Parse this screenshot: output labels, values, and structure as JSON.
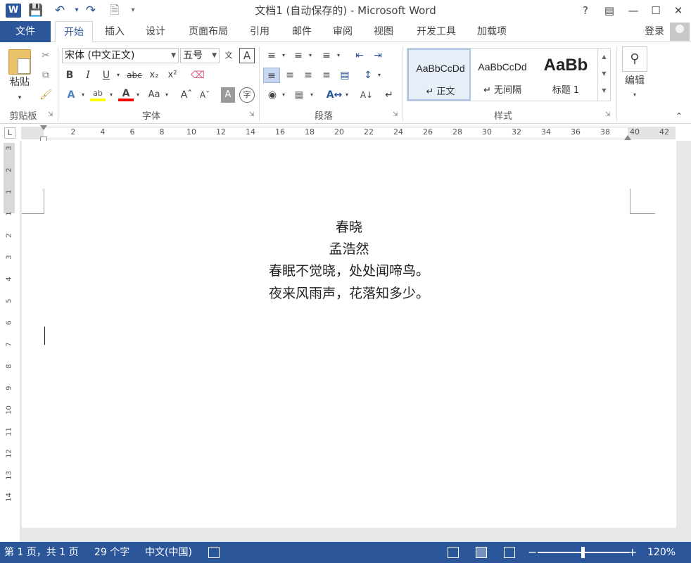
{
  "titlebar": {
    "app_icon": "W",
    "title": "文档1 (自动保存的) - Microsoft Word",
    "qat": [
      "save-icon",
      "undo-icon",
      "redo-icon",
      "print-preview-icon",
      "customize-qat-icon"
    ],
    "help": "?",
    "buttons": [
      "ribbon-display-icon",
      "minimize-icon",
      "maximize-icon",
      "close-icon"
    ]
  },
  "tabs": {
    "file": "文件",
    "items": [
      "开始",
      "插入",
      "设计",
      "页面布局",
      "引用",
      "邮件",
      "审阅",
      "视图",
      "开发工具",
      "加载项"
    ],
    "active": "开始",
    "login": "登录"
  },
  "ribbon": {
    "clipboard": {
      "paste": "粘贴",
      "label": "剪贴板"
    },
    "font": {
      "font_name": "宋体 (中文正文)",
      "font_size": "五号",
      "label": "字体"
    },
    "paragraph": {
      "label": "段落"
    },
    "styles": {
      "label": "样式",
      "items": [
        {
          "sample": "AaBbCcDd",
          "name": "↵ 正文"
        },
        {
          "sample": "AaBbCcDd",
          "name": "↵ 无间隔"
        },
        {
          "sample": "AaBb",
          "name": "标题 1"
        }
      ]
    },
    "editing": {
      "label": "编辑"
    }
  },
  "ruler": {
    "corner": "L",
    "numbers": [
      "2",
      "4",
      "6",
      "8",
      "10",
      "12",
      "14",
      "16",
      "18",
      "20",
      "22",
      "24",
      "26",
      "28",
      "30",
      "32",
      "34",
      "36",
      "38",
      "40",
      "42"
    ],
    "vertical_numbers": [
      "3",
      "2",
      "1",
      "1",
      "2",
      "3",
      "4",
      "5",
      "6",
      "7",
      "8",
      "9",
      "10",
      "11",
      "12",
      "13",
      "14"
    ]
  },
  "document": {
    "lines": [
      "春晓",
      "孟浩然",
      "春眠不觉晓，处处闻啼鸟。",
      "夜来风雨声，花落知多少。"
    ]
  },
  "status": {
    "page": "第 1 页，共 1 页",
    "words": "29 个字",
    "language": "中文(中国)",
    "zoom_minus": "−",
    "zoom_plus": "+",
    "zoom": "120%"
  },
  "colors": {
    "accent": "#2b579a",
    "highlight": "#ffff00",
    "font_color": "#ff0000"
  }
}
